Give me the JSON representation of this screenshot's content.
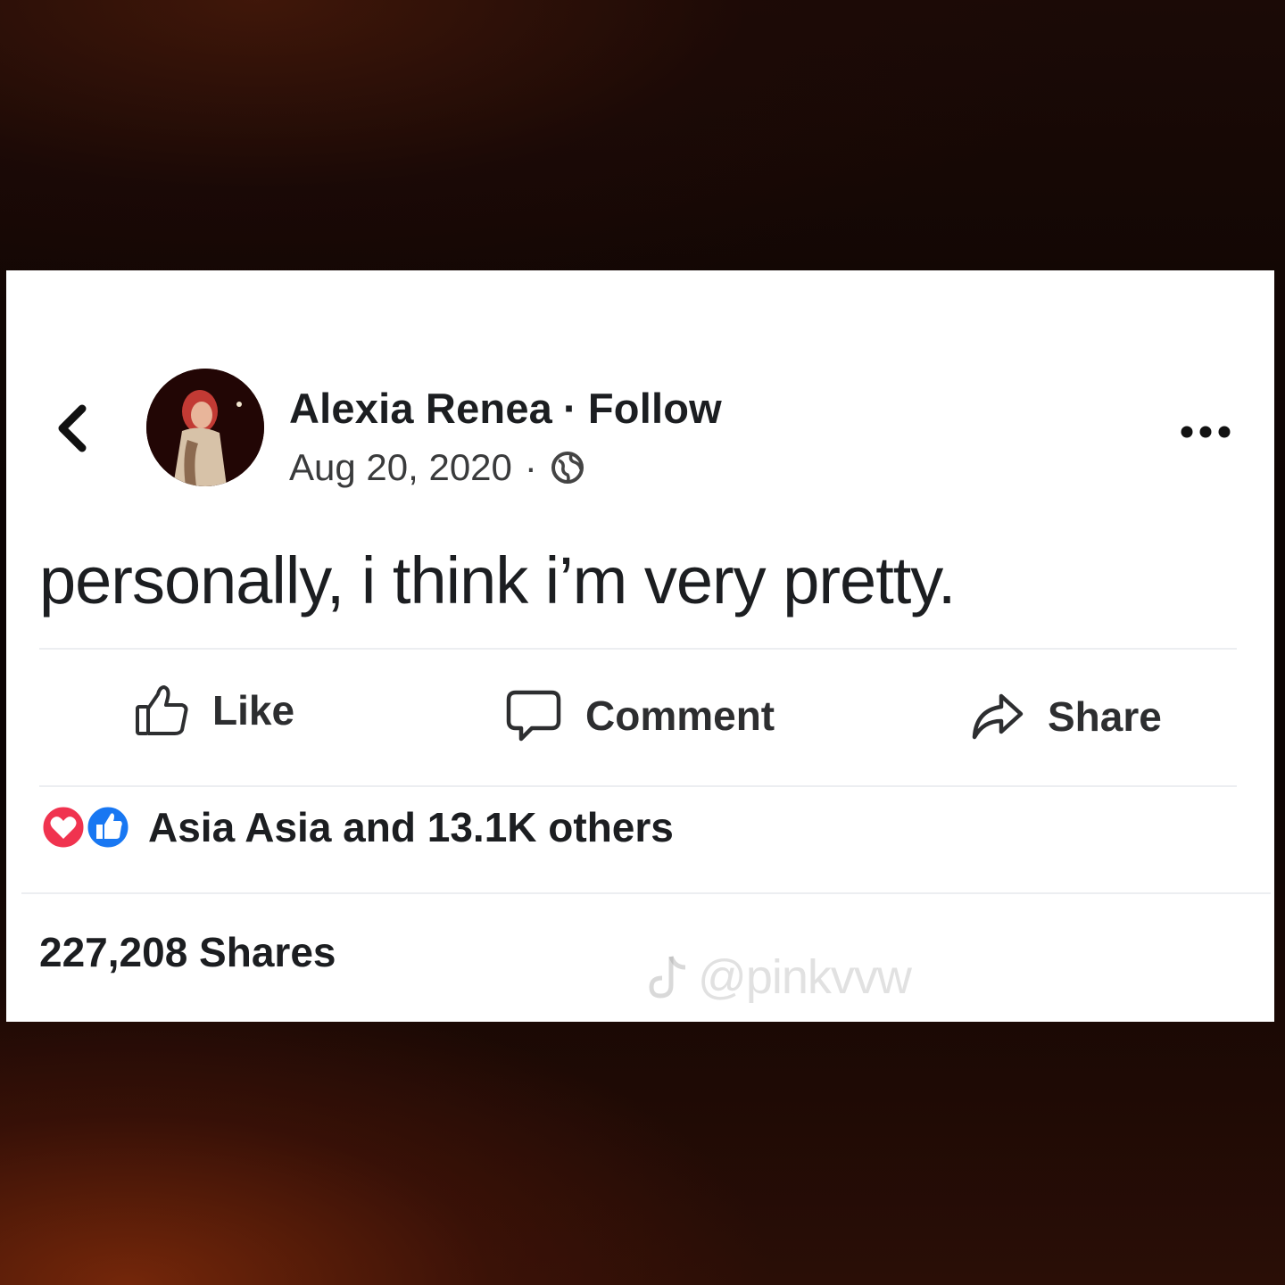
{
  "post": {
    "author": "Alexia Renea",
    "separator": "·",
    "follow_label": "Follow",
    "date": "Aug 20, 2020",
    "audience_icon": "globe-icon",
    "text": "personally, i think i’m very pretty.",
    "more_icon": "more-options-icon"
  },
  "actions": {
    "like_label": "Like",
    "comment_label": "Comment",
    "share_label": "Share"
  },
  "reactions": {
    "icons": [
      "love-reaction-icon",
      "like-reaction-icon"
    ],
    "summary": "Asia Asia and 13.1K others"
  },
  "shares_text": "227,208 Shares",
  "watermark": {
    "handle": "@pinkvvw",
    "icon": "tiktok-logo-icon"
  },
  "colors": {
    "love": "#f0334f",
    "like": "#1877f2",
    "text": "#1c1e21",
    "card": "#ffffff"
  }
}
